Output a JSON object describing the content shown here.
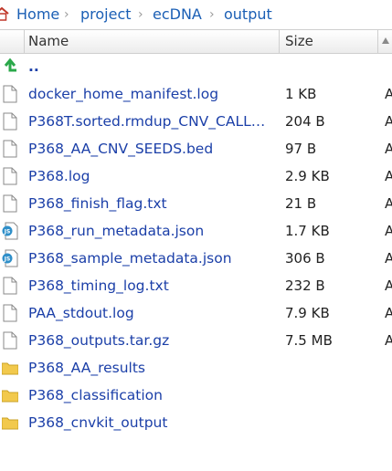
{
  "breadcrumb": {
    "items": [
      "Home",
      "project",
      "ecDNA",
      "output"
    ],
    "separator": "›"
  },
  "header": {
    "name_label": "Name",
    "size_label": "Size"
  },
  "rows": [
    {
      "type": "parent",
      "name": "..",
      "size": "",
      "modified": ""
    },
    {
      "type": "file",
      "name": "docker_home_manifest.log",
      "size": "1 KB",
      "modified": "A"
    },
    {
      "type": "file",
      "name": "P368T.sorted.rmdup_CNV_CALL…",
      "size": "204 B",
      "modified": "A"
    },
    {
      "type": "file",
      "name": "P368_AA_CNV_SEEDS.bed",
      "size": "97 B",
      "modified": "A"
    },
    {
      "type": "file",
      "name": "P368.log",
      "size": "2.9 KB",
      "modified": "A"
    },
    {
      "type": "file",
      "name": "P368_finish_flag.txt",
      "size": "21 B",
      "modified": "A"
    },
    {
      "type": "json",
      "name": "P368_run_metadata.json",
      "size": "1.7 KB",
      "modified": "A"
    },
    {
      "type": "json",
      "name": "P368_sample_metadata.json",
      "size": "306 B",
      "modified": "A"
    },
    {
      "type": "file",
      "name": "P368_timing_log.txt",
      "size": "232 B",
      "modified": "A"
    },
    {
      "type": "file",
      "name": "PAA_stdout.log",
      "size": "7.9 KB",
      "modified": "A"
    },
    {
      "type": "file",
      "name": "P368_outputs.tar.gz",
      "size": "7.5 MB",
      "modified": "A"
    },
    {
      "type": "folder",
      "name": "P368_AA_results",
      "size": "",
      "modified": ""
    },
    {
      "type": "folder",
      "name": "P368_classification",
      "size": "",
      "modified": ""
    },
    {
      "type": "folder",
      "name": "P368_cnvkit_output",
      "size": "",
      "modified": ""
    }
  ],
  "icons": {
    "parent": "up-arrow-icon",
    "file": "file-icon",
    "json": "json-file-icon",
    "folder": "folder-icon"
  },
  "colors": {
    "link": "#1b3fa8",
    "folder": "#f2c94c",
    "json_badge": "#2f8fc9",
    "up_arrow": "#2aa84a"
  }
}
